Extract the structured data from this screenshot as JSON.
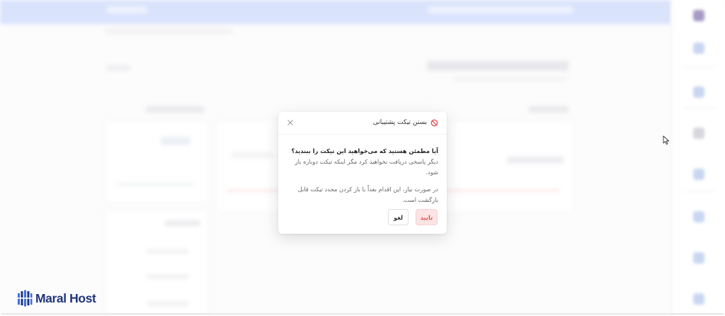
{
  "modal": {
    "title": "بستن تیکت پشتیبانی",
    "question": "آیا مطمئن هستید که می‌خواهید این تیکت را ببندید؟",
    "question_rest": " دیگر پاسخی دریافت نخواهید کرد مگر اینکه تیکت دوباره باز شود.",
    "note": "در صورت نیاز، این اقدام بعداً با باز کردن مجدد تیکت قابل بازگشت است.",
    "confirm_label": "تایید",
    "cancel_label": "لغو",
    "icons": {
      "title": "ban-icon",
      "close": "close-icon"
    },
    "colors": {
      "danger": "#e05353",
      "danger_bg": "#fce4e4"
    }
  },
  "brand": {
    "name": "Maral Host",
    "icon": "server-logo-icon",
    "color": "#22357a"
  }
}
